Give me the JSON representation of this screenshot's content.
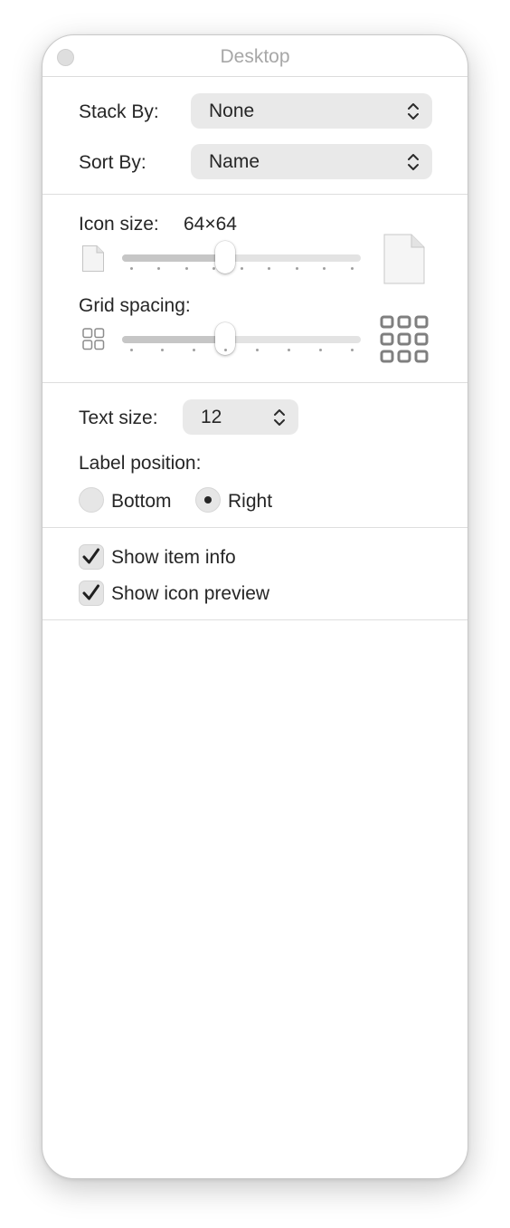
{
  "window": {
    "title": "Desktop"
  },
  "arrangement": {
    "stack_by_label": "Stack By:",
    "stack_by_value": "None",
    "sort_by_label": "Sort By:",
    "sort_by_value": "Name"
  },
  "icons": {
    "icon_size_label": "Icon size:",
    "icon_size_value": "64×64",
    "icon_size_level": 0.43,
    "grid_spacing_label": "Grid spacing:",
    "grid_spacing_level": 0.43
  },
  "text": {
    "text_size_label": "Text size:",
    "text_size_value": "12",
    "label_position_label": "Label position:",
    "bottom_label": "Bottom",
    "right_label": "Right",
    "selected_position": "Right"
  },
  "options": {
    "show_item_info_label": "Show item info",
    "show_item_info_checked": true,
    "show_icon_preview_label": "Show icon preview",
    "show_icon_preview_checked": true
  },
  "icon_names": [
    "close-icon",
    "chevron-updown-icon",
    "small-document-icon",
    "large-document-icon",
    "small-grid-icon",
    "large-grid-icon",
    "checkmark-icon"
  ]
}
